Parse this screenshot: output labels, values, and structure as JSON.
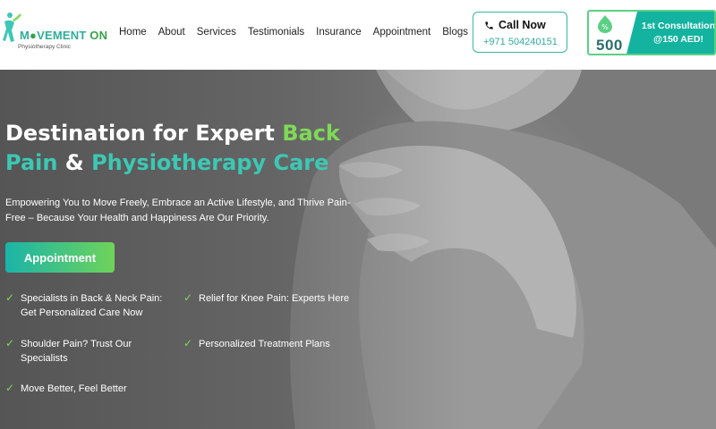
{
  "header": {
    "logo": {
      "text_main_a": "M",
      "text_main_b": "VEMENT",
      "text_main_c": " ON",
      "tagline": "Physiotherapy Clinic"
    },
    "nav": [
      {
        "label": "Home"
      },
      {
        "label": "About"
      },
      {
        "label": "Services"
      },
      {
        "label": "Testimonials"
      },
      {
        "label": "Insurance"
      },
      {
        "label": "Appointment"
      },
      {
        "label": "Blogs"
      }
    ],
    "call": {
      "label": "Call Now",
      "number": "+971 504240151",
      "icon": "phone-icon"
    },
    "promo": {
      "amount": "500",
      "line1": "1st Consultation",
      "line2": "@150 AED!",
      "icon": "percent-badge-icon"
    }
  },
  "hero": {
    "title_part1": "Destination for Expert ",
    "title_part2": "Back",
    "title_part3": "Pain",
    "title_part4": " & ",
    "title_part5": "Physiotherapy Care",
    "subtitle": "Empowering You to Move Freely, Embrace an Active Lifestyle, and Thrive Pain-Free – Because Your Health and Happiness Are Our Priority.",
    "button_label": "Appointment",
    "features": [
      {
        "text": "Specialists in Back & Neck Pain: Get Personalized Care Now",
        "icon": "check-icon"
      },
      {
        "text": "Relief for Knee Pain: Experts Here",
        "icon": "check-icon"
      },
      {
        "text": "Shoulder Pain? Trust Our Specialists",
        "icon": "check-icon"
      },
      {
        "text": "Personalized Treatment Plans",
        "icon": "check-icon"
      },
      {
        "text": "Move Better, Feel Better",
        "icon": "check-icon"
      }
    ],
    "colors": {
      "green": "#7ed957",
      "teal": "#3cc8b4",
      "button_start": "#1ab4a8",
      "button_end": "#6fd35a"
    }
  }
}
